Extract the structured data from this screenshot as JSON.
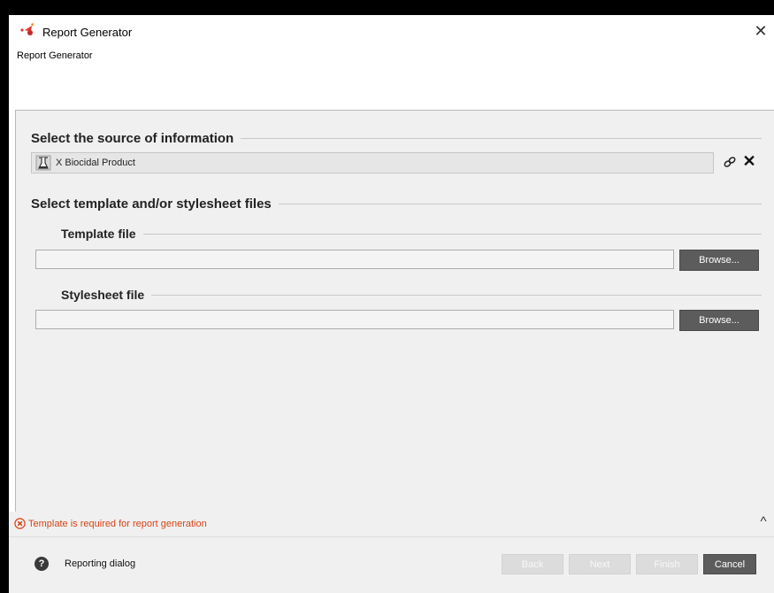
{
  "window": {
    "title": "Report Generator",
    "subtitle": "Report Generator",
    "close_glyph": "✕"
  },
  "source_section": {
    "legend": "Select the source of information",
    "selected": "X Biocidal Product",
    "item_icon": "flask-icon",
    "link_icon": "link-icon",
    "remove_glyph": "✕"
  },
  "templates_section": {
    "legend": "Select template and/or stylesheet files",
    "template": {
      "legend": "Template file",
      "value": "",
      "browse_label": "Browse..."
    },
    "stylesheet": {
      "legend": "Stylesheet file",
      "value": "",
      "browse_label": "Browse..."
    }
  },
  "validation": {
    "message": "Template is required for report generation",
    "icon": "error-circle-icon",
    "collapse_glyph": "^"
  },
  "footer": {
    "help_glyph": "?",
    "help_label": "Reporting dialog",
    "buttons": {
      "back": "Back",
      "next": "Next",
      "finish": "Finish",
      "cancel": "Cancel"
    }
  },
  "colors": {
    "error": "#d84315",
    "dark_button": "#5c5c5c",
    "disabled_button": "#dcdcdc",
    "panel": "#f0f0f0"
  }
}
